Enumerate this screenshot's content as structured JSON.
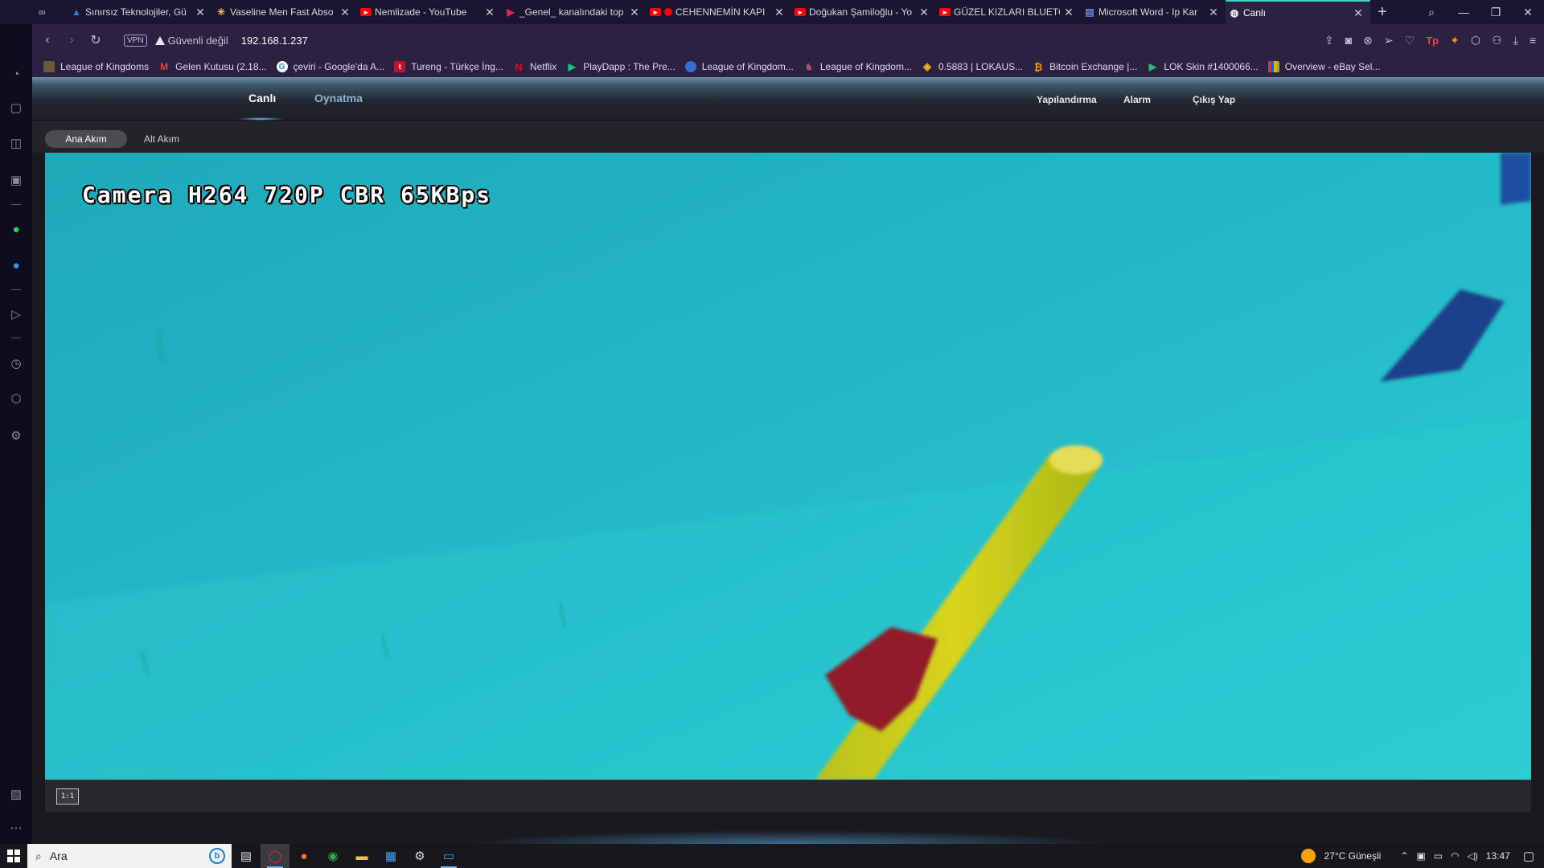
{
  "browser": {
    "tabs": [
      {
        "title": "Sınırsız Teknolojiler, Gü",
        "favicon": "triangle-logo-icon",
        "color": "#2b7de0",
        "active": false
      },
      {
        "title": "Vaseline Men Fast Abso",
        "favicon": "walmart-spark-icon",
        "color": "#ffc220",
        "active": false
      },
      {
        "title": "Nemlizade - YouTube",
        "favicon": "youtube-icon",
        "color": "#ff0000",
        "active": false
      },
      {
        "title": "_Genel_ kanalındaki top",
        "favicon": "play-logo-icon",
        "color": "#e0245e",
        "active": false
      },
      {
        "title": "CEHENNEMİN KAPI",
        "favicon": "youtube-icon",
        "color": "#ff0000",
        "active": false
      },
      {
        "title": "Doğukan Şamiloğlu - Yo",
        "favicon": "youtube-icon",
        "color": "#ff0000",
        "active": false
      },
      {
        "title": "GÜZEL KIZLARI BLUETO",
        "favicon": "youtube-icon",
        "color": "#ff0000",
        "active": false
      },
      {
        "title": "Microsoft Word - Ip Kar",
        "favicon": "document-icon",
        "color": "#4a6ee0",
        "active": false
      },
      {
        "title": "Canlı",
        "favicon": "globe-icon",
        "color": "#ffffff",
        "active": true
      }
    ],
    "address": {
      "vpn_label": "VPN",
      "security_text": "Güvenli değil",
      "url": "192.168.1.237"
    },
    "bookmarks": [
      {
        "label": "League of Kingdoms",
        "color": "#6b5a3a"
      },
      {
        "label": "Gelen Kutusu (2.18...",
        "color": "#ea4335"
      },
      {
        "label": "çeviri - Google'da A...",
        "color": "#4285f4"
      },
      {
        "label": "Tureng - Türkçe İng...",
        "color": "#c8102e"
      },
      {
        "label": "Netflix",
        "color": "#e50914"
      },
      {
        "label": "PlayDapp : The Pre...",
        "color": "#19c37d"
      },
      {
        "label": "League of Kingdom...",
        "color": "#2f6fd6"
      },
      {
        "label": "League of Kingdom...",
        "color": "#8a3a5a"
      },
      {
        "label": "0.5883 | LOKAUS...",
        "color": "#f0b90b"
      },
      {
        "label": "Bitcoin Exchange |...",
        "color": "#f7931a"
      },
      {
        "label": "LOK Skin #1400066...",
        "color": "#19c37d"
      },
      {
        "label": "Overview - eBay Sel...",
        "color": "#e53238"
      }
    ]
  },
  "camera_app": {
    "nav": {
      "live": "Canlı",
      "playback": "Oynatma",
      "config": "Yapılandırma",
      "alarm": "Alarm",
      "logout": "Çıkış Yap"
    },
    "streams": {
      "main": "Ana Akım",
      "sub": "Alt Akım"
    },
    "osd_text": "Camera H264 720P CBR 65KBps",
    "ratio_button": "1:1"
  },
  "taskbar": {
    "search_placeholder": "Ara",
    "weather": "27°C  Güneşli",
    "time": "13:47"
  },
  "colors": {
    "accent_teal": "#3fd0c6",
    "nav_active": "#ffffff",
    "nav_inactive": "#8fb2ce",
    "video_water": "#23b5c2"
  }
}
